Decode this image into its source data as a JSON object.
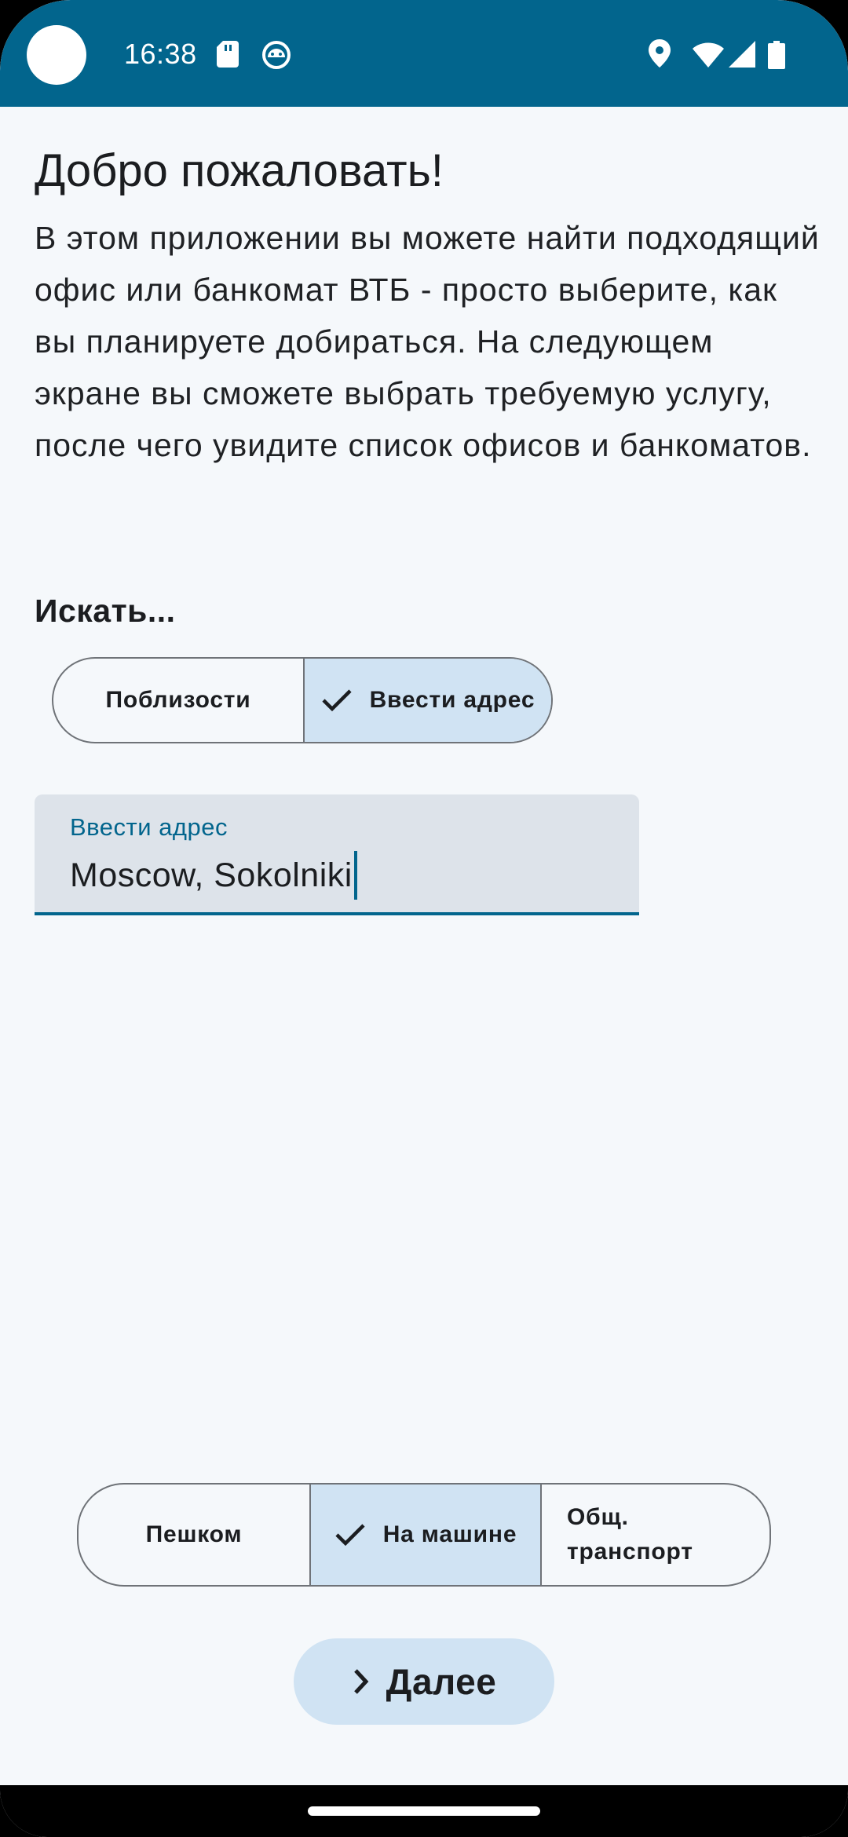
{
  "status_bar": {
    "time": "16:38",
    "icons": [
      "sd-card-icon",
      "android-bot-icon",
      "location-icon",
      "wifi-icon",
      "signal-icon",
      "battery-icon"
    ],
    "background": "#02658d"
  },
  "header": {
    "title": "Добро пожаловать!"
  },
  "intro": {
    "text": "В этом приложении вы можете найти подходящий офис или банкомат ВТБ - просто выберите, как вы планируете добираться. На следующем экране вы сможете выбрать требуемую услугу, после чего увидите список офисов и банкоматов."
  },
  "search": {
    "label": "Искать...",
    "options": [
      {
        "label": "Поблизости",
        "selected": false
      },
      {
        "label": "Ввести адрес",
        "selected": true
      }
    ]
  },
  "address_field": {
    "label": "Ввести адрес",
    "value": "Moscow, Sokolniki"
  },
  "transport": {
    "options": [
      {
        "label": "Пешком",
        "selected": false
      },
      {
        "label": "На машине",
        "selected": true
      },
      {
        "label": "Общ. транспорт",
        "selected": false
      }
    ]
  },
  "next_button": {
    "label": "Далее"
  },
  "colors": {
    "primary": "#02658d",
    "selected_segment": "#d0e3f3",
    "background": "#f5f8fb",
    "field_background": "#dde3ea"
  }
}
